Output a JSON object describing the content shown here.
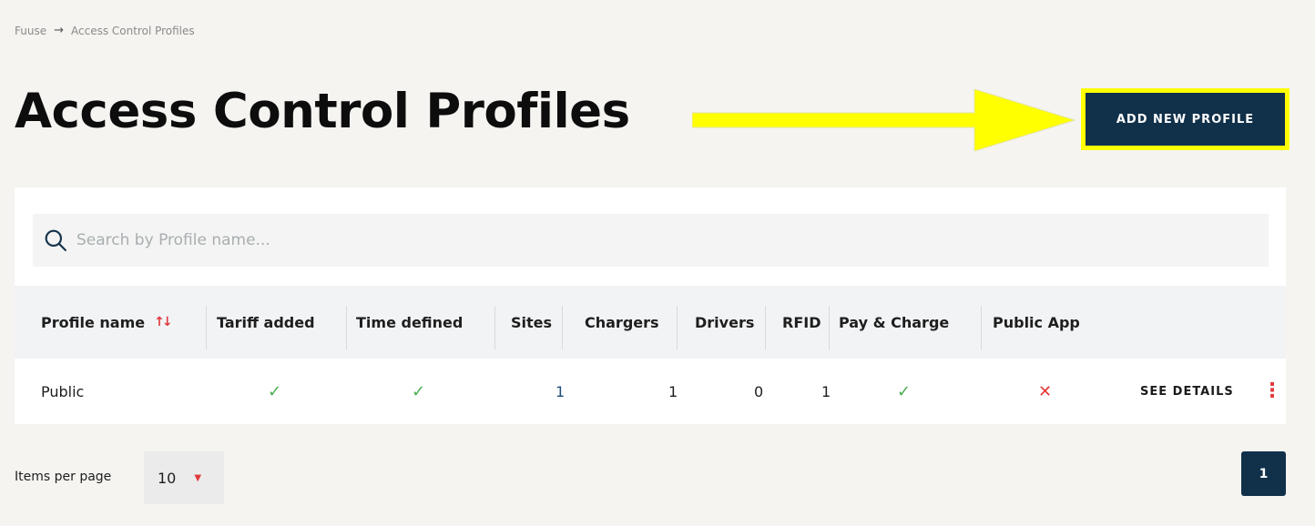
{
  "breadcrumb": {
    "root": "Fuuse",
    "current": "Access Control Profiles"
  },
  "page": {
    "title": "Access Control Profiles",
    "add_button": "ADD NEW PROFILE"
  },
  "search": {
    "placeholder": "Search by Profile name..."
  },
  "table": {
    "columns": [
      "Profile name",
      "Tariff added",
      "Time defined",
      "Sites",
      "Chargers",
      "Drivers",
      "RFID",
      "Pay & Charge",
      "Public App"
    ],
    "rows": [
      {
        "profile_name": "Public",
        "tariff_added": "✓",
        "time_defined": "✓",
        "sites": "1",
        "chargers": "1",
        "drivers": "0",
        "rfid": "1",
        "pay_and_charge": "✓",
        "public_app": "✕",
        "action": "SEE DETAILS"
      }
    ]
  },
  "pagination": {
    "items_per_page_label": "Items per page",
    "items_per_page_value": "10",
    "current_page": "1"
  },
  "colors": {
    "primary": "#11304a",
    "accent": "#e0393e",
    "highlight": "#ffff00",
    "check": "#4caf50"
  },
  "icons": {
    "search": "search-icon",
    "sort": "sort-icon",
    "more": "kebab-menu-icon",
    "caret": "caret-down-icon",
    "arrow": "arrow-right-icon"
  }
}
